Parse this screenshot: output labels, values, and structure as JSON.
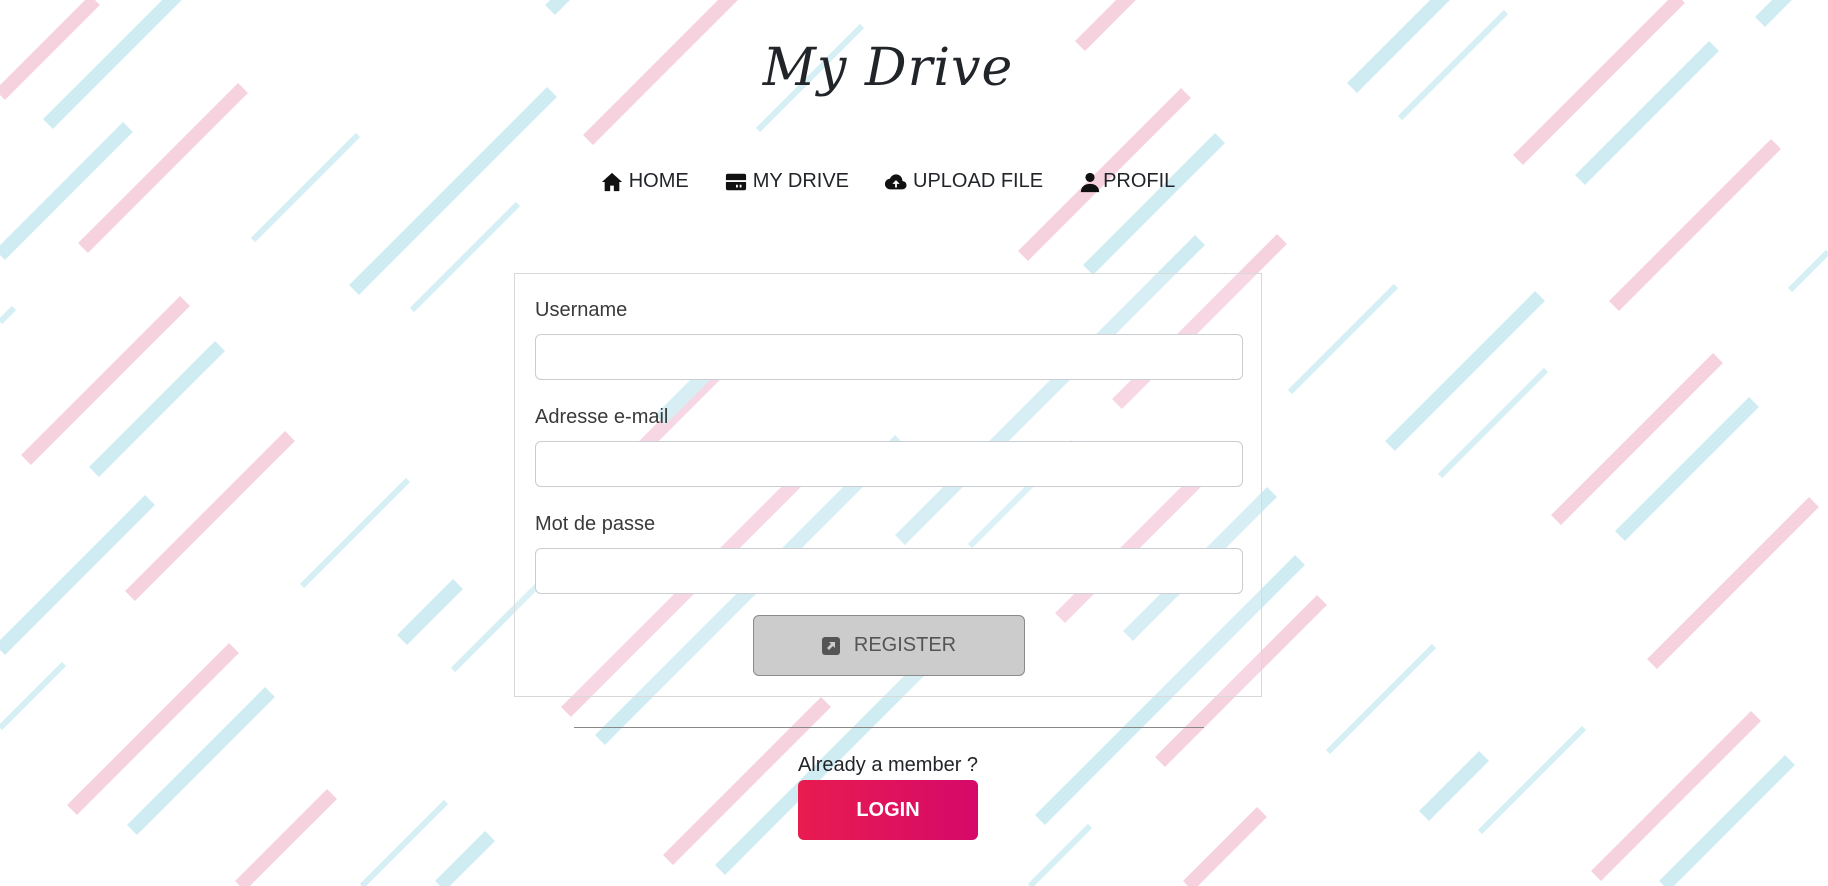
{
  "brand": {
    "title": "My Drive"
  },
  "nav": {
    "items": [
      {
        "label": "HOME",
        "icon": "house-icon"
      },
      {
        "label": "MY DRIVE",
        "icon": "drive-icon"
      },
      {
        "label": "UPLOAD FILE",
        "icon": "cloud-upload-icon"
      },
      {
        "label": "PROFIL",
        "icon": "user-icon"
      }
    ]
  },
  "form": {
    "username_label": "Username",
    "username_value": "",
    "email_label": "Adresse e-mail",
    "email_value": "",
    "password_label": "Mot de passe",
    "password_value": "",
    "register_label": "REGISTER",
    "register_icon": "external-link-square-icon"
  },
  "footer": {
    "member_text": "Already a member ?",
    "login_label": "LOGIN"
  },
  "colors": {
    "stripe_pink": "#f2b8cc",
    "stripe_blue": "#b3e0ec",
    "login_start": "#e81c4f",
    "login_end": "#d6096a",
    "register_bg": "#cccccc"
  }
}
